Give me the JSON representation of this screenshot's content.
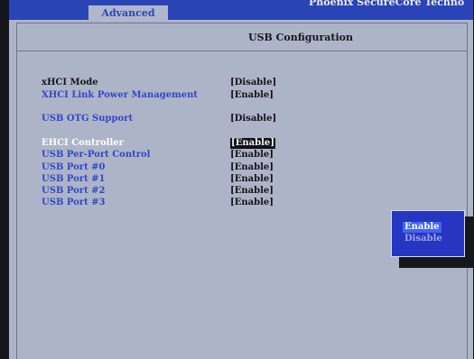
{
  "header": {
    "tab_label": "Advanced",
    "vendor": "Phoenix SecureCore Techno"
  },
  "page": {
    "title": "USB Configuration"
  },
  "settings": [
    {
      "label": "xHCI Mode",
      "value": "[Disable]"
    },
    {
      "label": "XHCI Link Power Management",
      "value": "[Enable]"
    },
    {
      "label": "USB OTG Support",
      "value": "[Disable]"
    },
    {
      "label": "EHCI Controller",
      "value": "[Enable]"
    },
    {
      "label": "USB Per-Port Control",
      "value": "[Enable]"
    },
    {
      "label": "USB Port #0",
      "value": "[Enable]"
    },
    {
      "label": "USB Port #1",
      "value": "[Enable]"
    },
    {
      "label": "USB Port #2",
      "value": "[Enable]"
    },
    {
      "label": "USB Port #3",
      "value": "[Enable]"
    }
  ],
  "popup": {
    "options": [
      "Enable",
      "Disable"
    ],
    "selected": "Enable"
  },
  "colors": {
    "background": "#aeb4c8",
    "header_bar": "#2a44b8",
    "label_blue": "#2f47c9",
    "popup_blue": "#2537c2"
  }
}
